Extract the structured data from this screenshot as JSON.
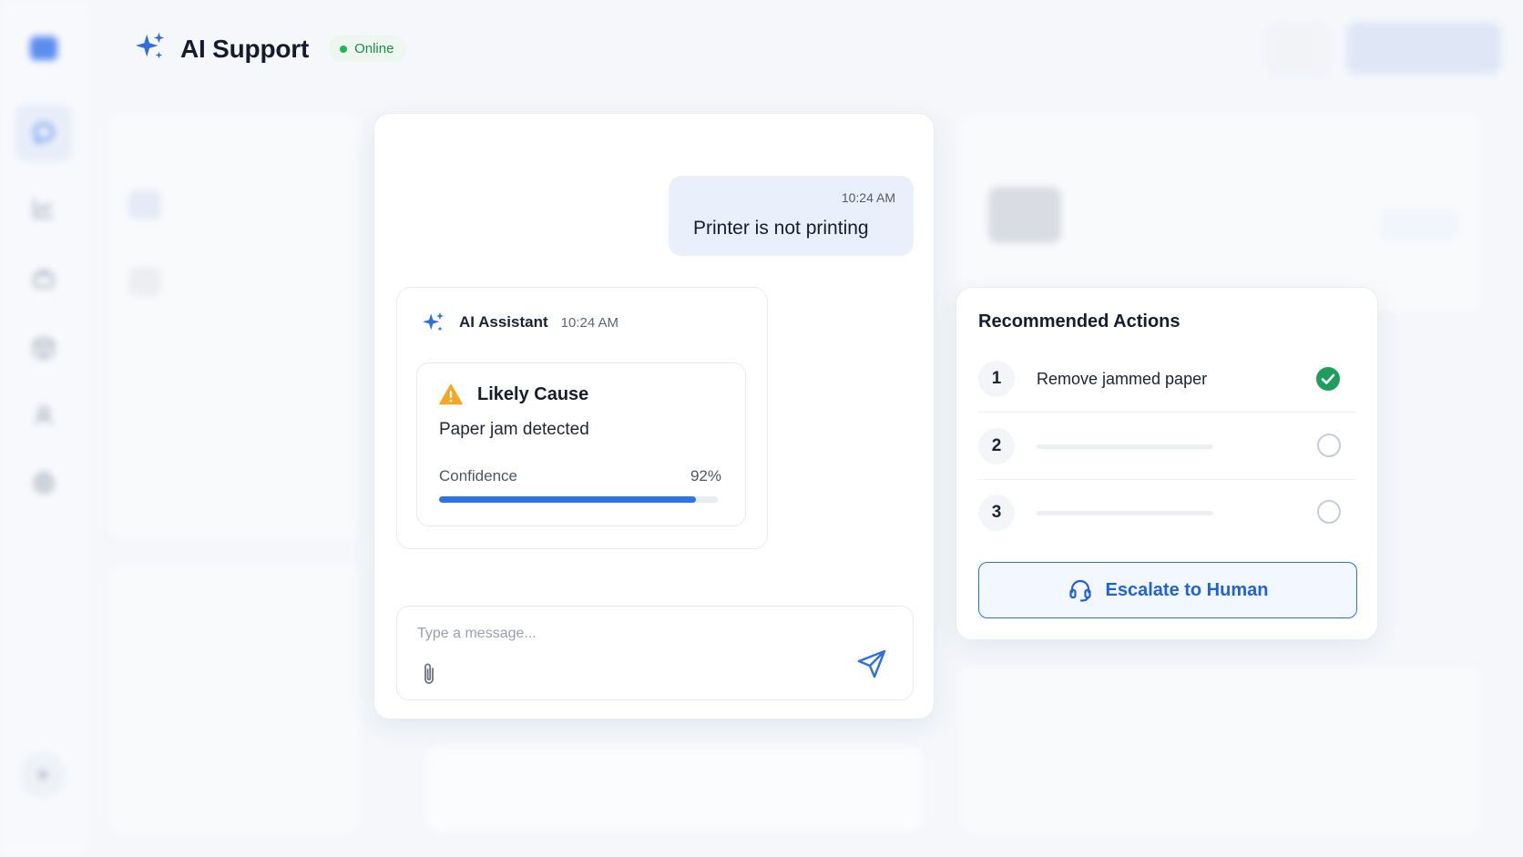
{
  "header": {
    "title": "AI Support",
    "status": "Online"
  },
  "chat": {
    "user_message": {
      "time": "10:24 AM",
      "text": "Printer is not printing"
    },
    "ai_message": {
      "sender": "AI Assistant",
      "time": "10:24 AM",
      "cause_title": "Likely Cause",
      "cause_text": "Paper jam detected",
      "confidence_label": "Confidence",
      "confidence_value": "92%",
      "confidence_fraction": 0.92
    },
    "composer": {
      "placeholder": "Type a message..."
    }
  },
  "actions": {
    "title": "Recommended Actions",
    "items": [
      {
        "number": "1",
        "label": "Remove jammed paper",
        "done": true
      },
      {
        "number": "2",
        "label": "",
        "done": false
      },
      {
        "number": "3",
        "label": "",
        "done": false
      }
    ],
    "escalate_label": "Escalate to Human"
  },
  "colors": {
    "accent": "#2d74e4",
    "success": "#1f9d5c",
    "warning": "#f5a623",
    "online": "#22b15c"
  },
  "icons": {
    "sparkle": "sparkle-icon",
    "warning": "warning-icon",
    "attach": "paperclip-icon",
    "send": "send-icon",
    "check": "check-circle-icon",
    "headset": "headset-icon"
  }
}
